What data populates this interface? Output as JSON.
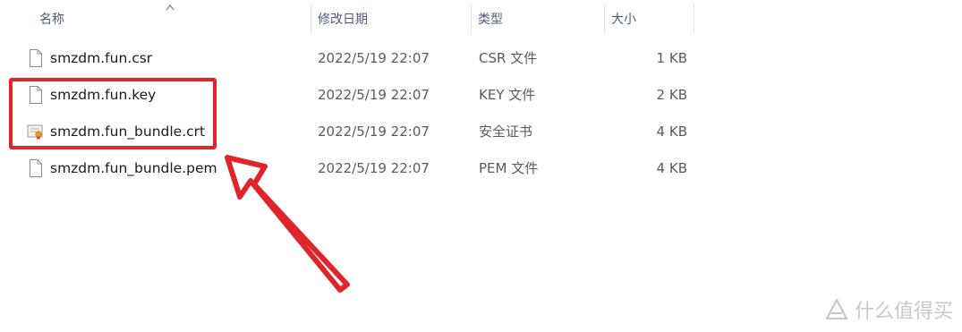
{
  "columns": {
    "name": "名称",
    "date": "修改日期",
    "type": "类型",
    "size": "大小"
  },
  "files": [
    {
      "name": "smzdm.fun.csr",
      "date": "2022/5/19 22:07",
      "type": "CSR 文件",
      "size": "1 KB",
      "icon": "document-icon"
    },
    {
      "name": "smzdm.fun.key",
      "date": "2022/5/19 22:07",
      "type": "KEY 文件",
      "size": "2 KB",
      "icon": "document-icon"
    },
    {
      "name": "smzdm.fun_bundle.crt",
      "date": "2022/5/19 22:07",
      "type": "安全证书",
      "size": "4 KB",
      "icon": "certificate-icon"
    },
    {
      "name": "smzdm.fun_bundle.pem",
      "date": "2022/5/19 22:07",
      "type": "PEM 文件",
      "size": "4 KB",
      "icon": "document-icon"
    }
  ],
  "annotation_color": "#e0242b",
  "watermark": {
    "text": "什么值得买"
  }
}
